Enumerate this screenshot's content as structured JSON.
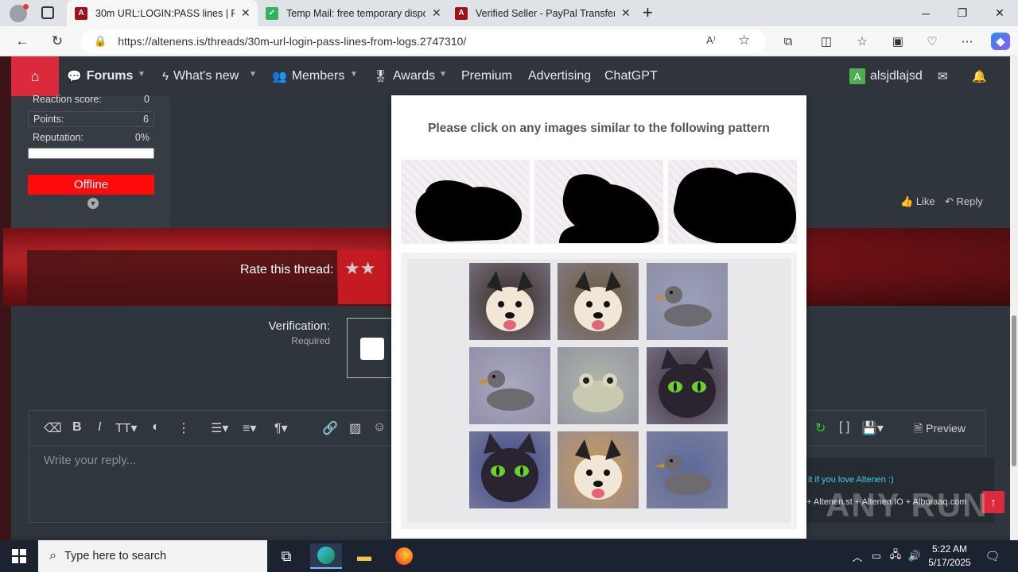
{
  "browser": {
    "tabs": [
      {
        "title": "30m URL:LOGIN:PASS lines | Fron",
        "active": true
      },
      {
        "title": "Temp Mail: free temporary dispo",
        "active": false
      },
      {
        "title": "Verified Seller - PayPal Transfers",
        "active": false
      }
    ],
    "new_tab": "+",
    "url": "https://altenens.is/threads/30m-url-login-pass-lines-from-logs.2747310/"
  },
  "site_nav": {
    "items": [
      "Forums",
      "What's new",
      "Members",
      "Awards",
      "Premium",
      "Advertising",
      "ChatGPT"
    ],
    "username": "alsjdlajsd",
    "avatar_letter": "A"
  },
  "user_panel": {
    "reaction_label": "Reaction score:",
    "reaction_value": "0",
    "points_label": "Points:",
    "points_value": "6",
    "reputation_label": "Reputation:",
    "reputation_value": "0%",
    "status": "Offline"
  },
  "post_actions": {
    "like": "Like",
    "reply": "Reply"
  },
  "rate_thread": {
    "label": "Rate this thread:"
  },
  "verification": {
    "label": "Verification:",
    "sublabel": "Required"
  },
  "editor": {
    "placeholder": "Write your reply...",
    "preview": "Preview"
  },
  "side_text": {
    "line1": "it if you love Altenen :)",
    "line2": "+ Altenen.st + Altenen.IO + Alboraaq.com"
  },
  "captcha": {
    "title": "Please click on any images similar to the following pattern",
    "pattern_subject": "frog-silhouette",
    "grid": [
      {
        "subject": "dog",
        "color": "#3a2c22"
      },
      {
        "subject": "dog",
        "color": "#6b5a3a"
      },
      {
        "subject": "duck",
        "color": "#9aa0b8"
      },
      {
        "subject": "duck",
        "color": "#a8a8c0"
      },
      {
        "subject": "frog",
        "color": "#b0b8a8"
      },
      {
        "subject": "cat",
        "color": "#3a2f38"
      },
      {
        "subject": "cat",
        "color": "#3d4a8a"
      },
      {
        "subject": "dog",
        "color": "#c99a5a"
      },
      {
        "subject": "duck",
        "color": "#5a6a9a"
      }
    ]
  },
  "watermark": "ANY RUN",
  "taskbar": {
    "search_placeholder": "Type here to search",
    "time": "5:22 AM",
    "date": "5/17/2025"
  }
}
